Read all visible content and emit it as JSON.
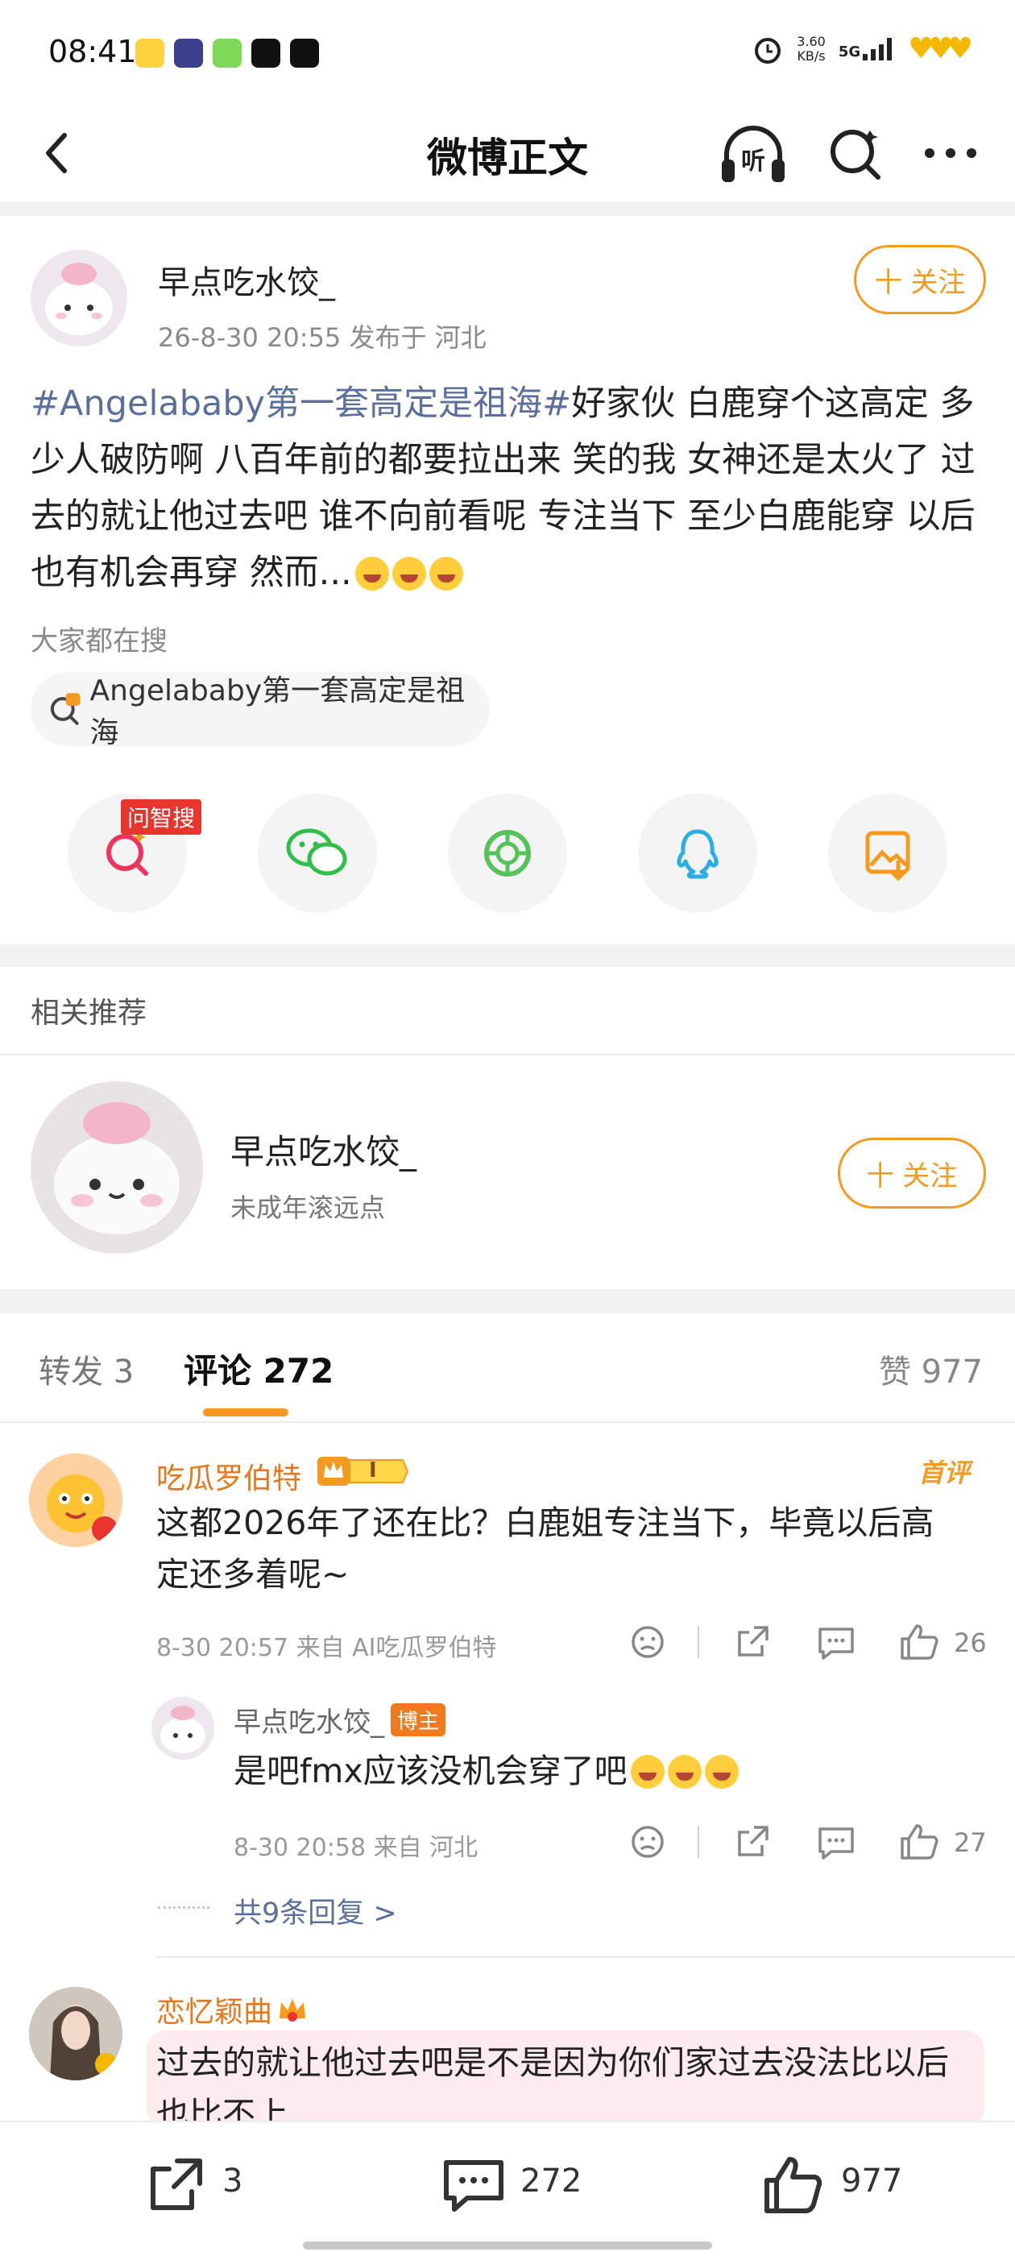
{
  "status_bar": {
    "time": "08:41",
    "speed_value": "3.60",
    "speed_unit": "KB/s",
    "network": "5G"
  },
  "nav": {
    "title": "微博正文",
    "listen_label": "听"
  },
  "post": {
    "author": "早点吃水饺_",
    "meta": "26-8-30 20:55  发布于 河北",
    "follow_label": "十 关注",
    "hashtag": "#Angelababy第一套高定是祖海#",
    "body": "好家伙 白鹿穿个这高定 多少人破防啊 八百年前的都要拉出来 笑的我 女神还是太火了 过去的就让他过去吧 谁不向前看呢 专注当下 至少白鹿能穿 以后也有机会再穿 然而...",
    "hot_search_label": "大家都在搜",
    "hot_search_item": "Angelababy第一套高定是祖海",
    "share_badge": "问智搜"
  },
  "related": {
    "title": "相关推荐",
    "name": "早点吃水饺_",
    "desc": "未成年滚远点",
    "follow_label": "十 关注"
  },
  "tabs": {
    "repost": "转发 3",
    "comment": "评论 272",
    "like": "赞 977"
  },
  "comments": [
    {
      "name": "吃瓜罗伯特",
      "level": "I",
      "first_label": "首评",
      "text": "这都2026年了还在比？白鹿姐专注当下，毕竟以后高定还多着呢~",
      "meta": "8-30 20:57  来自 AI吃瓜罗伯特",
      "likes": "26"
    },
    {
      "name": "早点吃水饺_",
      "badge": "博主",
      "text": "是吧fmx应该没机会穿了吧",
      "meta": "8-30 20:58  来自 河北",
      "likes": "27"
    },
    {
      "more": "共9条回复 >"
    },
    {
      "name": "恋忆颖曲",
      "text": "过去的就让他过去吧是不是因为你们家过去没法比以后也比不上"
    }
  ],
  "bottom_bar": {
    "repost_count": "3",
    "comment_count": "272",
    "like_count": "977"
  },
  "colors": {
    "accent": "#f39a1f",
    "link": "#5b6f9c",
    "badge_red": "#e8352e"
  }
}
